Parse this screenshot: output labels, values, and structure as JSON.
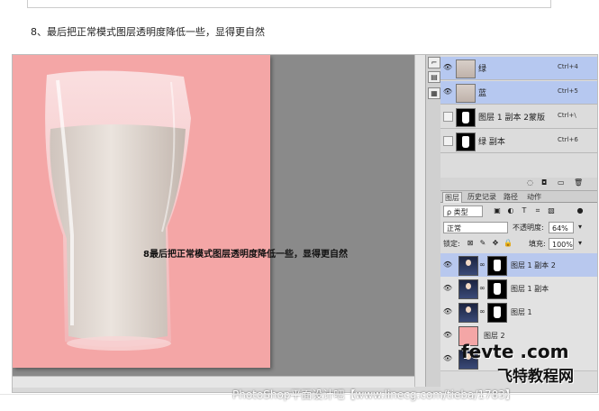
{
  "caption": "8、最后把正常模式图层透明度降低一些，显得更自然",
  "canvas_overlay_text": "8最后把正常模式图层透明度降低一些，显得更自然",
  "channels": [
    {
      "name": "绿",
      "shortcut": "Ctrl+4",
      "selected": true,
      "thumb": "glass",
      "visible": true
    },
    {
      "name": "蓝",
      "shortcut": "Ctrl+5",
      "selected": true,
      "thumb": "glass",
      "visible": true
    },
    {
      "name": "图层 1 副本 2蒙版",
      "shortcut": "Ctrl+\\",
      "selected": false,
      "thumb": "mask",
      "visible": false
    },
    {
      "name": "绿 副本",
      "shortcut": "Ctrl+6",
      "selected": false,
      "thumb": "mask",
      "visible": false
    }
  ],
  "tabs": [
    "图层",
    "历史记录",
    "路径",
    "动作"
  ],
  "filter": {
    "label": "ρ 类型"
  },
  "blend": {
    "mode": "正常",
    "opacity_label": "不透明度:",
    "opacity": "64%"
  },
  "lock": {
    "label": "锁定:",
    "fill_label": "填充:",
    "fill": "100%"
  },
  "layers": [
    {
      "name": "图层 1 副本 2",
      "selected": true,
      "thumb": "person",
      "mask": true
    },
    {
      "name": "图层 1 副本",
      "selected": false,
      "thumb": "person",
      "mask": true
    },
    {
      "name": "图层 1",
      "selected": false,
      "thumb": "person",
      "mask": true
    },
    {
      "name": "图层 2",
      "selected": false,
      "thumb": "pink",
      "mask": false
    },
    {
      "name": "",
      "selected": false,
      "thumb": "person",
      "mask": false
    }
  ],
  "watermark": {
    "site": "fevte .com",
    "brand": "飞特教程网",
    "url": "PhotoShop平面设计吧【www.linecg.com/tieba/1783】"
  },
  "colors": {
    "canvas_bg": "#f4a6a6",
    "workspace": "#8a8a8a",
    "selection": "#b6c8f0"
  }
}
